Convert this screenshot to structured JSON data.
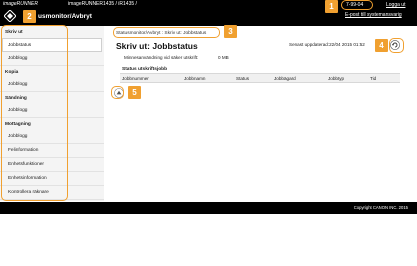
{
  "header": {
    "brand": "imageRUNNER",
    "model": "imageRUNNER1435 / iR1435 /",
    "app_title": "usmonitor/Avbryt",
    "user": "7-99-04",
    "logout": "Logga ut",
    "mail": "E-post till systemansvarig"
  },
  "sidebar": {
    "groups": [
      {
        "heading": "Skriv ut",
        "items": [
          "Jobbstatus",
          "Jobblogg"
        ]
      },
      {
        "heading": "Kopia",
        "items": [
          "Jobblogg"
        ]
      },
      {
        "heading": "Sändning",
        "items": [
          "Jobblogg"
        ]
      },
      {
        "heading": "Mottagning",
        "items": [
          "Jobblogg",
          "Felinformation",
          "Enhetsfunktioner",
          "Enhetsinformation",
          "Kontrollera räknare"
        ]
      }
    ]
  },
  "main": {
    "breadcrumb": "Statusmonitor/Avbryt : Skriv ut: Jobbstatus",
    "title": "Skriv ut: Jobbstatus",
    "updated": "Senast uppdaterad:22/04 2015 01:52",
    "memory_label": "Minnesanvändning vid säker utskrift:",
    "memory_value": "0 MB",
    "section_label": "Status utskriftsjobb",
    "columns": [
      "Jobbnummer",
      "Jobbnamn",
      "Status",
      "Jobbägard",
      "Jobbtyp",
      "Tid"
    ]
  },
  "badges": [
    "1",
    "2",
    "3",
    "4",
    "5"
  ],
  "footer": {
    "copyright": "Copyright CANON INC. 2015"
  },
  "colors": {
    "accent": "#f0a030",
    "bar": "#000000",
    "sidebar": "#f4f4f4"
  }
}
